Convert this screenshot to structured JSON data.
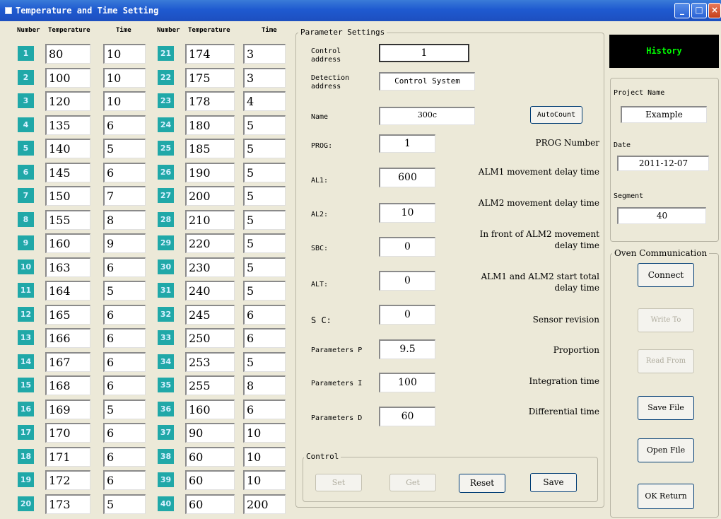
{
  "window": {
    "title": "Temperature and Time Setting"
  },
  "table": {
    "headers": {
      "number": "Number",
      "temperature": "Temperature",
      "time": "Time"
    },
    "rows": [
      {
        "n": "1",
        "t": "80",
        "time": "10"
      },
      {
        "n": "2",
        "t": "100",
        "time": "10"
      },
      {
        "n": "3",
        "t": "120",
        "time": "10"
      },
      {
        "n": "4",
        "t": "135",
        "time": "6"
      },
      {
        "n": "5",
        "t": "140",
        "time": "5"
      },
      {
        "n": "6",
        "t": "145",
        "time": "6"
      },
      {
        "n": "7",
        "t": "150",
        "time": "7"
      },
      {
        "n": "8",
        "t": "155",
        "time": "8"
      },
      {
        "n": "9",
        "t": "160",
        "time": "9"
      },
      {
        "n": "10",
        "t": "163",
        "time": "6"
      },
      {
        "n": "11",
        "t": "164",
        "time": "5"
      },
      {
        "n": "12",
        "t": "165",
        "time": "6"
      },
      {
        "n": "13",
        "t": "166",
        "time": "6"
      },
      {
        "n": "14",
        "t": "167",
        "time": "6"
      },
      {
        "n": "15",
        "t": "168",
        "time": "6"
      },
      {
        "n": "16",
        "t": "169",
        "time": "5"
      },
      {
        "n": "17",
        "t": "170",
        "time": "6"
      },
      {
        "n": "18",
        "t": "171",
        "time": "6"
      },
      {
        "n": "19",
        "t": "172",
        "time": "6"
      },
      {
        "n": "20",
        "t": "173",
        "time": "5"
      },
      {
        "n": "21",
        "t": "174",
        "time": "3"
      },
      {
        "n": "22",
        "t": "175",
        "time": "3"
      },
      {
        "n": "23",
        "t": "178",
        "time": "4"
      },
      {
        "n": "24",
        "t": "180",
        "time": "5"
      },
      {
        "n": "25",
        "t": "185",
        "time": "5"
      },
      {
        "n": "26",
        "t": "190",
        "time": "5"
      },
      {
        "n": "27",
        "t": "200",
        "time": "5"
      },
      {
        "n": "28",
        "t": "210",
        "time": "5"
      },
      {
        "n": "29",
        "t": "220",
        "time": "5"
      },
      {
        "n": "30",
        "t": "230",
        "time": "5"
      },
      {
        "n": "31",
        "t": "240",
        "time": "5"
      },
      {
        "n": "32",
        "t": "245",
        "time": "6"
      },
      {
        "n": "33",
        "t": "250",
        "time": "6"
      },
      {
        "n": "34",
        "t": "253",
        "time": "5"
      },
      {
        "n": "35",
        "t": "255",
        "time": "8"
      },
      {
        "n": "36",
        "t": "160",
        "time": "6"
      },
      {
        "n": "37",
        "t": "90",
        "time": "10"
      },
      {
        "n": "38",
        "t": "60",
        "time": "10"
      },
      {
        "n": "39",
        "t": "60",
        "time": "10"
      },
      {
        "n": "40",
        "t": "60",
        "time": "200"
      }
    ]
  },
  "params": {
    "group_label": "Parameter Settings",
    "control_address_label": "Control address",
    "control_address_value": "1",
    "detection_address_label": "Detection address",
    "detection_address_value": "Control System",
    "name_label": "Name",
    "name_value": "300c",
    "autocount_label": "AutoCount",
    "prog_label": "PROG:",
    "prog_value": "1",
    "prog_desc": "PROG Number",
    "al1_label": "AL1:",
    "al1_value": "600",
    "al1_desc": "ALM1 movement delay time",
    "al2_label": "AL2:",
    "al2_value": "10",
    "al2_desc": "ALM2 movement delay time",
    "sbc_label": "SBC:",
    "sbc_value": "0",
    "sbc_desc_1": "In front of ALM2 movement",
    "sbc_desc_2": "delay time",
    "alt_label": "ALT:",
    "alt_value": "0",
    "alt_desc_1": "ALM1 and ALM2 start total",
    "alt_desc_2": "delay time",
    "sc_label": "S C:",
    "sc_value": "0",
    "sc_desc": "Sensor revision",
    "p_label": "Parameters P",
    "p_value": "9.5",
    "p_desc": "Proportion",
    "i_label": "Parameters I",
    "i_value": "100",
    "i_desc": "Integration time",
    "d_label": "Parameters D",
    "d_value": "60",
    "d_desc": "Differential time"
  },
  "control": {
    "group_label": "Control",
    "set_label": "Set",
    "get_label": "Get",
    "reset_label": "Reset",
    "save_label": "Save"
  },
  "side": {
    "history_label": "History",
    "project_name_label": "Project Name",
    "project_name_value": "Example",
    "date_label": "Date",
    "date_value": "2011-12-07",
    "segment_label": "Segment",
    "segment_value": "40",
    "oven_label": "Oven Communication",
    "connect_label": "Connect",
    "write_label": "Write To",
    "read_label": "Read From",
    "save_file_label": "Save File",
    "open_file_label": "Open File",
    "ok_return_label": "OK Return"
  },
  "colors": {
    "titlebar": "#1f5ad0",
    "number_badge": "#20a8a8",
    "history_text": "#00ff00",
    "window_bg": "#ece9d8"
  }
}
